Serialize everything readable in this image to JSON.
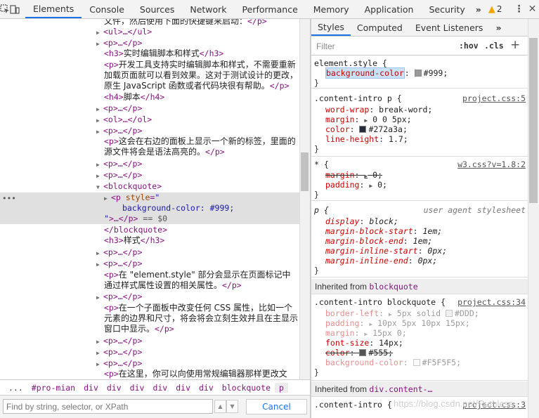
{
  "toolbar": {
    "tabs": [
      "Elements",
      "Console",
      "Sources",
      "Network",
      "Performance",
      "Memory",
      "Application",
      "Security"
    ],
    "more": "»",
    "warn_count": "2",
    "icons": [
      "inspect-icon",
      "device-toolbar-icon",
      "warning-icon",
      "kebab-menu-icon",
      "close-icon"
    ]
  },
  "dom": {
    "l1": "文件，然后使用下面的快捷键来启动：",
    "l2_tag": "<ul>…</ul>",
    "l3_tag": "<p>…</p>",
    "h3_1": "实时编辑脚本和样式",
    "p_long_1": "开发工具支持实时编辑脚本和样式，不需要重新",
    "p_long_2": "加载页面就可以看到效果。这对于测试设计的更改，",
    "p_long_3": "原生 JavaScript 函数或者代码块很有帮助。",
    "h4": "脚本",
    "p_right_1": "这会在右边的面板上显示一个新的标签，里面的",
    "p_right_2": "源文件将会是语法高亮的。",
    "blockquote": "blockquote",
    "sel_attr_name": "style",
    "sel_attr_val": "background-color: #999;",
    "sel_eq": "== $0",
    "h3_2": "样式",
    "p_es_1": "在 \"element.style\" 部分会显示在页面标记中",
    "p_es_2": "通过样式属性设置的相关属性。",
    "p_css_1": "在一个子面板中改变任何 CSS 属性，比如一个",
    "p_css_2": "元素的边界和尺寸，将会将会立刻生效并且在主显示",
    "p_css_3": "窗口中显示。",
    "p_last": "在这里，你可以向使用常规编辑器那样更改文"
  },
  "breadcrumb": {
    "items": [
      "...",
      "#pro-mian",
      "div",
      "div",
      "div",
      "div",
      "div",
      "div",
      "blockquote",
      "p"
    ]
  },
  "search": {
    "placeholder": "Find by string, selector, or XPath",
    "cancel": "Cancel"
  },
  "styles": {
    "tabs": [
      "Styles",
      "Computed",
      "Event Listeners",
      "»"
    ],
    "filter_placeholder": "Filter",
    "hov": ":hov",
    "cls": ".cls",
    "plus": "+",
    "rules": {
      "element_style": {
        "selector": "element.style {",
        "prop": "background-color",
        "value": "#999;"
      },
      "content_intro": {
        "selector": ".content-intro p {",
        "source": "project.css:5",
        "props": [
          [
            "word-wrap",
            "break-word;"
          ],
          [
            "margin",
            "0 0 5px;"
          ],
          [
            "color",
            "#272a3a;"
          ],
          [
            "line-height",
            "1.7;"
          ]
        ]
      },
      "star": {
        "selector": "* {",
        "source": "w3.css?v=1.8:2",
        "props": [
          [
            "margin",
            "0;"
          ],
          [
            "padding",
            "0;"
          ]
        ]
      },
      "ua": {
        "selector": "p {",
        "source": "user agent stylesheet",
        "props": [
          [
            "display",
            "block;"
          ],
          [
            "margin-block-start",
            "1em;"
          ],
          [
            "margin-block-end",
            "1em;"
          ],
          [
            "margin-inline-start",
            "0px;"
          ],
          [
            "margin-inline-end",
            "0px;"
          ]
        ]
      }
    },
    "inherited_bq": {
      "label": "Inherited from",
      "selector": "blockquote"
    },
    "bq_rule": {
      "selector": ".content-intro blockquote {",
      "source": "project.css:34",
      "props": [
        [
          "border-left",
          "5px solid",
          "#DDD;"
        ],
        [
          "padding",
          "10px 5px 10px 15px;"
        ],
        [
          "margin",
          "15px 0;"
        ],
        [
          "font-size",
          "14px;"
        ],
        [
          "color",
          "#555;"
        ],
        [
          "background-color",
          "#F5F5F5;"
        ]
      ]
    },
    "inherited_div": {
      "label": "Inherited from",
      "selector": "div.content-…"
    },
    "last_rule": {
      "selector": ".content-intro {",
      "source": "project.css:3"
    }
  },
  "watermark": "https://blog.csdn.net/Ruthless_",
  "colors": {
    "accent": "#1a73e8",
    "tag": "#881280",
    "prop": "#c80000",
    "swatch_999": "#999999",
    "swatch_272a3a": "#272a3a",
    "swatch_ddd": "#DDDDDD",
    "swatch_555": "#555555",
    "swatch_f5": "#F5F5F5"
  }
}
